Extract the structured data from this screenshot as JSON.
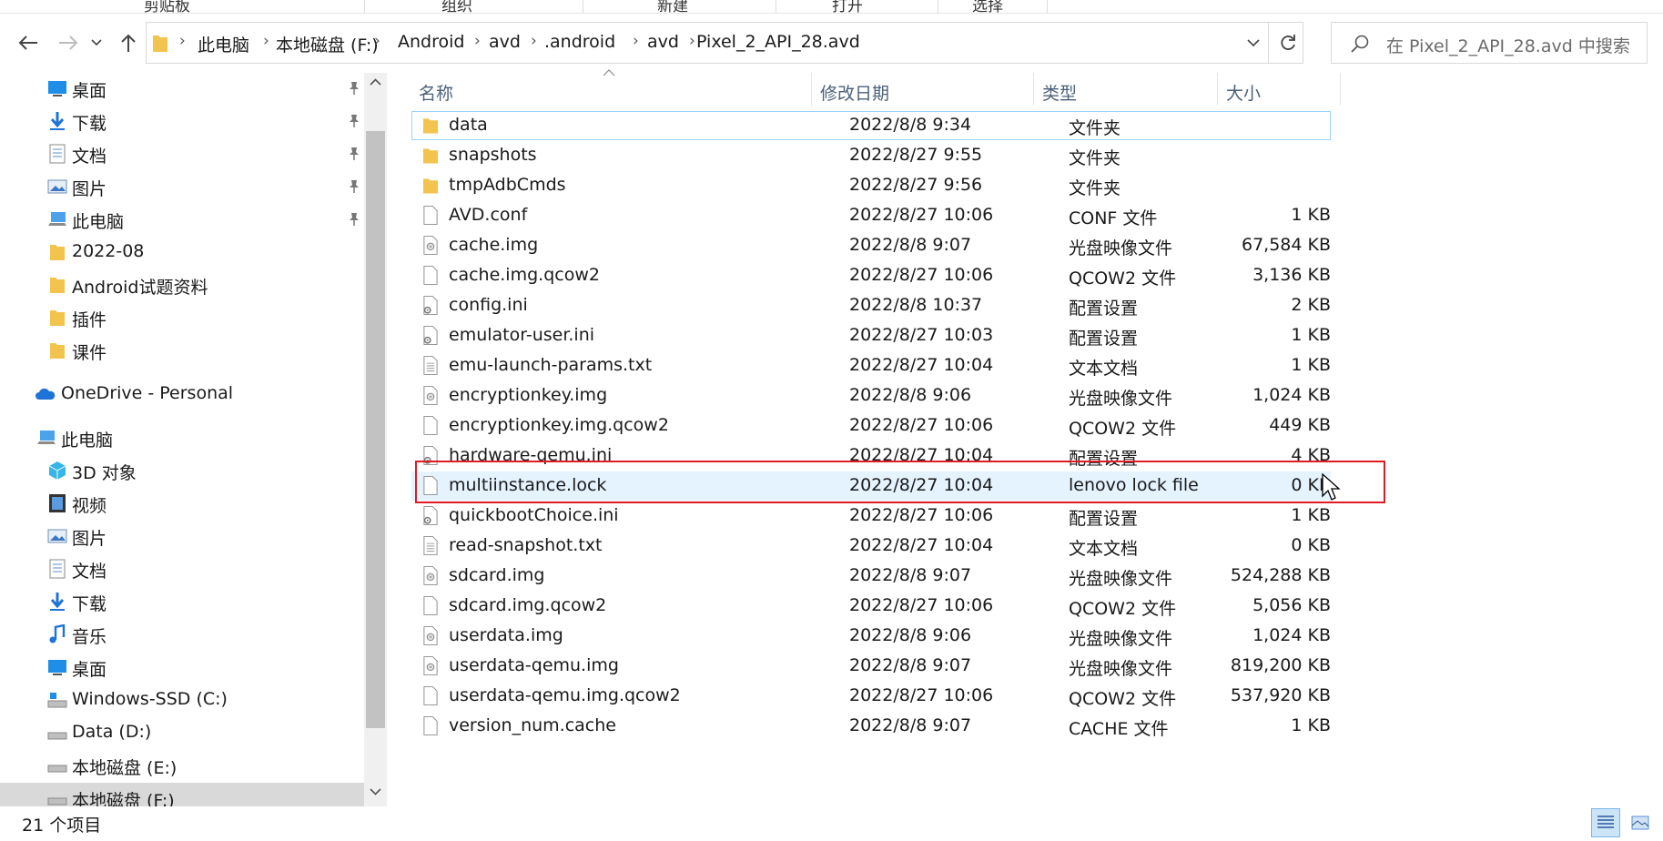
{
  "ribbon": {
    "groups": [
      "剪贴板",
      "组织",
      "新建",
      "打开",
      "选择"
    ]
  },
  "address": {
    "breadcrumbs": [
      "此电脑",
      "本地磁盘 (F:)",
      "Android",
      "avd",
      ".android",
      "avd",
      "Pixel_2_API_28.avd"
    ],
    "search_placeholder": "在 Pixel_2_API_28.avd 中搜索"
  },
  "nav": {
    "quick_access": [
      {
        "label": "桌面",
        "icon": "desktop-icon",
        "pinned": true
      },
      {
        "label": "下载",
        "icon": "download-icon",
        "pinned": true
      },
      {
        "label": "文档",
        "icon": "documents-icon",
        "pinned": true
      },
      {
        "label": "图片",
        "icon": "pictures-icon",
        "pinned": true
      },
      {
        "label": "此电脑",
        "icon": "computer-icon",
        "pinned": true
      },
      {
        "label": "2022-08",
        "icon": "folder-icon",
        "pinned": false
      },
      {
        "label": "Android试题资料",
        "icon": "folder-icon",
        "pinned": false
      },
      {
        "label": "插件",
        "icon": "folder-icon",
        "pinned": false
      },
      {
        "label": "课件",
        "icon": "folder-icon",
        "pinned": false
      }
    ],
    "onedrive": "OneDrive - Personal",
    "this_pc": "此电脑",
    "pc_items": [
      {
        "label": "3D 对象",
        "icon": "3d-objects-icon"
      },
      {
        "label": "视频",
        "icon": "videos-icon"
      },
      {
        "label": "图片",
        "icon": "pictures-icon"
      },
      {
        "label": "文档",
        "icon": "documents-icon"
      },
      {
        "label": "下载",
        "icon": "download-icon"
      },
      {
        "label": "音乐",
        "icon": "music-icon"
      },
      {
        "label": "桌面",
        "icon": "desktop-icon"
      },
      {
        "label": "Windows-SSD (C:)",
        "icon": "system-drive-icon"
      },
      {
        "label": "Data (D:)",
        "icon": "drive-icon"
      },
      {
        "label": "本地磁盘 (E:)",
        "icon": "drive-icon"
      },
      {
        "label": "本地磁盘 (F:)",
        "icon": "drive-icon",
        "selected": true
      }
    ]
  },
  "columns": {
    "name": "名称",
    "date": "修改日期",
    "type": "类型",
    "size": "大小"
  },
  "files": [
    {
      "name": "data",
      "date": "2022/8/8 9:34",
      "type": "文件夹",
      "size": "",
      "icon": "folder-icon"
    },
    {
      "name": "snapshots",
      "date": "2022/8/27 9:55",
      "type": "文件夹",
      "size": "",
      "icon": "folder-icon"
    },
    {
      "name": "tmpAdbCmds",
      "date": "2022/8/27 9:56",
      "type": "文件夹",
      "size": "",
      "icon": "folder-icon"
    },
    {
      "name": "AVD.conf",
      "date": "2022/8/27 10:06",
      "type": "CONF 文件",
      "size": "1 KB",
      "icon": "file-icon"
    },
    {
      "name": "cache.img",
      "date": "2022/8/8 9:07",
      "type": "光盘映像文件",
      "size": "67,584 KB",
      "icon": "disc-image-icon"
    },
    {
      "name": "cache.img.qcow2",
      "date": "2022/8/27 10:06",
      "type": "QCOW2 文件",
      "size": "3,136 KB",
      "icon": "file-icon"
    },
    {
      "name": "config.ini",
      "date": "2022/8/8 10:37",
      "type": "配置设置",
      "size": "2 KB",
      "icon": "settings-file-icon"
    },
    {
      "name": "emulator-user.ini",
      "date": "2022/8/27 10:03",
      "type": "配置设置",
      "size": "1 KB",
      "icon": "settings-file-icon"
    },
    {
      "name": "emu-launch-params.txt",
      "date": "2022/8/27 10:04",
      "type": "文本文档",
      "size": "1 KB",
      "icon": "text-file-icon"
    },
    {
      "name": "encryptionkey.img",
      "date": "2022/8/8 9:06",
      "type": "光盘映像文件",
      "size": "1,024 KB",
      "icon": "disc-image-icon"
    },
    {
      "name": "encryptionkey.img.qcow2",
      "date": "2022/8/27 10:06",
      "type": "QCOW2 文件",
      "size": "449 KB",
      "icon": "file-icon"
    },
    {
      "name": "hardware-qemu.ini",
      "date": "2022/8/27 10:04",
      "type": "配置设置",
      "size": "4 KB",
      "icon": "settings-file-icon"
    },
    {
      "name": "multiinstance.lock",
      "date": "2022/8/27 10:04",
      "type": "lenovo lock file",
      "size": "0 KB",
      "icon": "file-icon"
    },
    {
      "name": "quickbootChoice.ini",
      "date": "2022/8/27 10:06",
      "type": "配置设置",
      "size": "1 KB",
      "icon": "settings-file-icon"
    },
    {
      "name": "read-snapshot.txt",
      "date": "2022/8/27 10:04",
      "type": "文本文档",
      "size": "0 KB",
      "icon": "text-file-icon"
    },
    {
      "name": "sdcard.img",
      "date": "2022/8/8 9:07",
      "type": "光盘映像文件",
      "size": "524,288 KB",
      "icon": "disc-image-icon"
    },
    {
      "name": "sdcard.img.qcow2",
      "date": "2022/8/27 10:06",
      "type": "QCOW2 文件",
      "size": "5,056 KB",
      "icon": "file-icon"
    },
    {
      "name": "userdata.img",
      "date": "2022/8/8 9:06",
      "type": "光盘映像文件",
      "size": "1,024 KB",
      "icon": "disc-image-icon"
    },
    {
      "name": "userdata-qemu.img",
      "date": "2022/8/8 9:07",
      "type": "光盘映像文件",
      "size": "819,200 KB",
      "icon": "disc-image-icon"
    },
    {
      "name": "userdata-qemu.img.qcow2",
      "date": "2022/8/27 10:06",
      "type": "QCOW2 文件",
      "size": "537,920 KB",
      "icon": "file-icon"
    },
    {
      "name": "version_num.cache",
      "date": "2022/8/8 9:07",
      "type": "CACHE 文件",
      "size": "1 KB",
      "icon": "file-icon"
    }
  ],
  "status": {
    "item_count": "21 个项目"
  },
  "colors": {
    "highlight": "#e01b24",
    "folder": "#f3c44d",
    "selection": "#e5f3ff",
    "accent": "#0078d4"
  }
}
